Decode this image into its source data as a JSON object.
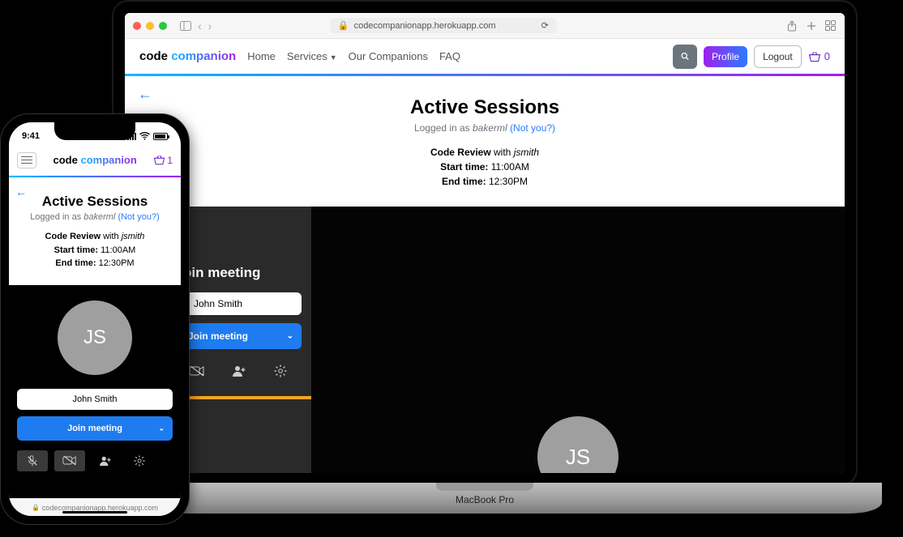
{
  "browser": {
    "url": "codecompanionapp.herokuapp.com"
  },
  "brand": {
    "part1": "code ",
    "part2": "companion"
  },
  "nav": {
    "home": "Home",
    "services": "Services",
    "companions": "Our Companions",
    "faq": "FAQ",
    "profile": "Profile",
    "logout": "Logout",
    "cart_count": "0"
  },
  "page": {
    "title": "Active Sessions",
    "logged_prefix": "Logged in as ",
    "logged_user": "bakerml",
    "not_you": "(Not you?)",
    "session_type": "Code Review",
    "with": " with ",
    "companion": "jsmith",
    "start_label": "Start time:",
    "start_value": " 11:00AM",
    "end_label": "End time:",
    "end_value": " 12:30PM"
  },
  "video": {
    "join_title": "Join meeting",
    "participant_name": "John Smith",
    "join_button": "Join meeting",
    "avatar_initials": "JS"
  },
  "laptop": {
    "brand": "MacBook Pro"
  },
  "phone": {
    "time": "9:41",
    "url": "codecompanionapp.herokuapp.com",
    "cart_count": "1"
  }
}
